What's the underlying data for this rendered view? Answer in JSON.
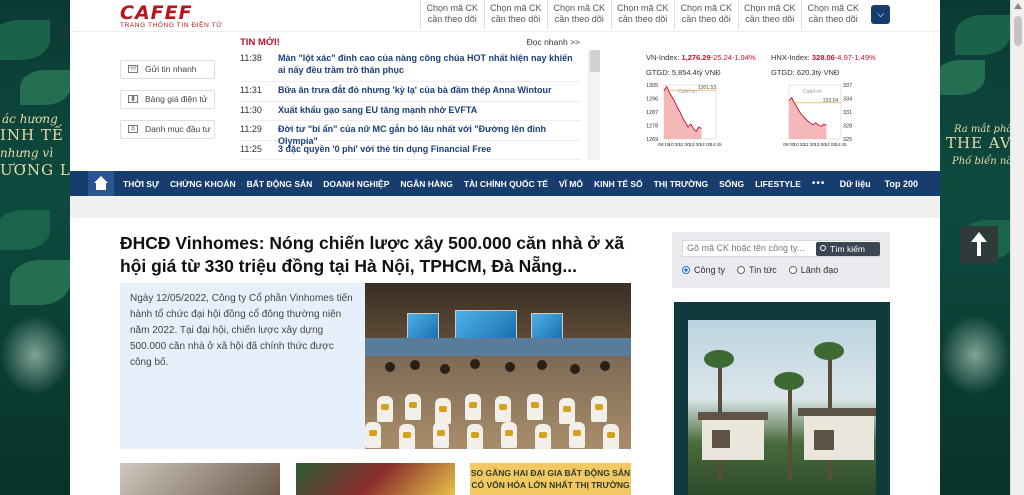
{
  "logo": {
    "word": "CAFEF",
    "tagline": "TRANG THÔNG TIN ĐIỆN TỬ"
  },
  "watchlist": {
    "buttons": [
      {
        "l1": "Chọn mã CK",
        "l2": "cần theo dõi"
      },
      {
        "l1": "Chọn mã CK",
        "l2": "cần theo dõi"
      },
      {
        "l1": "Chọn mã CK",
        "l2": "cần theo dõi"
      },
      {
        "l1": "Chọn mã CK",
        "l2": "cần theo dõi"
      },
      {
        "l1": "Chọn mã CK",
        "l2": "cần theo dõi"
      },
      {
        "l1": "Chọn mã CK",
        "l2": "cần theo dõi"
      },
      {
        "l1": "Chọn mã CK",
        "l2": "cần theo dõi"
      }
    ],
    "dropdown_icon": "chevron-down-icon"
  },
  "utilities": [
    {
      "label": "Gửi tin nhanh",
      "icon": "mail-icon"
    },
    {
      "label": "Bảng giá điện tử",
      "icon": "chart-icon"
    },
    {
      "label": "Danh mục đầu tư",
      "icon": "dollar-icon"
    }
  ],
  "ticker": {
    "title": "TIN MỚI!",
    "read_fast": "Đọc nhanh >>",
    "items": [
      {
        "time": "11:38",
        "title": "Màn \"lột xác\" đỉnh cao của nàng công chúa HOT nhất hiện nay khiến ai nấy đều trầm trồ thán phục"
      },
      {
        "time": "11:31",
        "title": "Bữa ăn trưa đắt đỏ nhưng 'kỳ lạ' của bà đầm thép Anna Wintour"
      },
      {
        "time": "11:30",
        "title": "Xuất khẩu gạo sang EU tăng mạnh nhờ EVFTA"
      },
      {
        "time": "11:29",
        "title": "Đời tư \"bí ẩn\" của nữ MC gắn bó lâu nhất với \"Đường lên đỉnh Olympia\""
      },
      {
        "time": "11:25",
        "title": "3 đặc quyền '0 phí' với thẻ tín dụng Financial Free"
      }
    ]
  },
  "market": {
    "vn": {
      "label": "VN-Index:",
      "value": "1,276.29",
      "change": "-25.24-1.94%",
      "gtgd": "GTGD: 5,854.4tỷ VNĐ",
      "yticks": [
        "1305",
        "1296",
        "1287",
        "1278",
        "1269"
      ],
      "xticks": [
        "09:15",
        "10:30",
        "11:30",
        "13:00",
        "14:00",
        "14:45"
      ],
      "ref_label": "1301.53",
      "brand": "Cafef.vn",
      "series": [
        1301,
        1304,
        1300,
        1297,
        1294,
        1290,
        1287,
        1283,
        1280,
        1277,
        1279,
        1276,
        1274,
        1277,
        1276
      ]
    },
    "hnx": {
      "label": "HNX-Index:",
      "value": "328.06",
      "change": "-4.97-1.49%",
      "gtgd": "GTGD: 620.3tỷ VNĐ",
      "yticks": [
        "337",
        "334",
        "331",
        "328",
        "325"
      ],
      "xticks": [
        "09:00",
        "10:00",
        "11:30",
        "13:00",
        "14:00",
        "14:45"
      ],
      "ref_label": "333.04",
      "brand": "Cafef.vn",
      "series": [
        333.5,
        334.2,
        333.0,
        332.1,
        331.0,
        330.2,
        329.6,
        329.0,
        328.5,
        328.2,
        328.6,
        328.1,
        327.8,
        328.3,
        328.06
      ]
    }
  },
  "nav": {
    "items": [
      "THỜI SỰ",
      "CHỨNG KHOÁN",
      "BẤT ĐỘNG SẢN",
      "DOANH NGHIỆP",
      "NGÂN HÀNG",
      "TÀI CHÍNH QUỐC TẾ",
      "VĨ MÔ",
      "KINH TẾ SỐ",
      "THỊ TRƯỜNG",
      "SỐNG",
      "LIFESTYLE"
    ],
    "more": "•••",
    "right": [
      "Dữ liệu",
      "Top 200"
    ]
  },
  "featured": {
    "headline": "ĐHCĐ Vinhomes: Nóng chiến lược xây 500.000 căn nhà ở xã hội giá từ 330 triệu đồng tại Hà Nội, TPHCM, Đà Nẵng...",
    "sapo": "Ngày 12/05/2022, Công ty Cổ phần Vinhomes tiến hành tổ chức đại hội đồng cổ đông thường niên năm 2022. Tại đại hội, chiến lược xây dựng 500.000 căn nhà ở xã hội đã chính thức được công bố."
  },
  "thumbs": {
    "third_line1": "SO GĂNG HAI ĐẠI GIA BẤT ĐỘNG SẢN",
    "third_line2": "CÓ VỐN HÓA LỚN NHẤT THỊ TRƯỜNG"
  },
  "search": {
    "placeholder": "Gõ mã CK hoặc tên công ty...",
    "button": "Tìm kiếm",
    "options": [
      {
        "label": "Công ty",
        "checked": true
      },
      {
        "label": "Tin tức",
        "checked": false
      },
      {
        "label": "Lãnh đạo",
        "checked": false
      }
    ]
  },
  "side_banners": {
    "left_lines": [
      "ác hương",
      "INH TẾ",
      "nhưng vì",
      "ƯƠNG LƯU"
    ],
    "right_lines": [
      "Ra mắt phân",
      "THE AVE",
      "Phố biển năng"
    ]
  },
  "colors": {
    "brand_red": "#b5151d",
    "nav_blue": "#173d6e",
    "down_red": "#c8102e",
    "link_blue": "#1a3e7a"
  }
}
